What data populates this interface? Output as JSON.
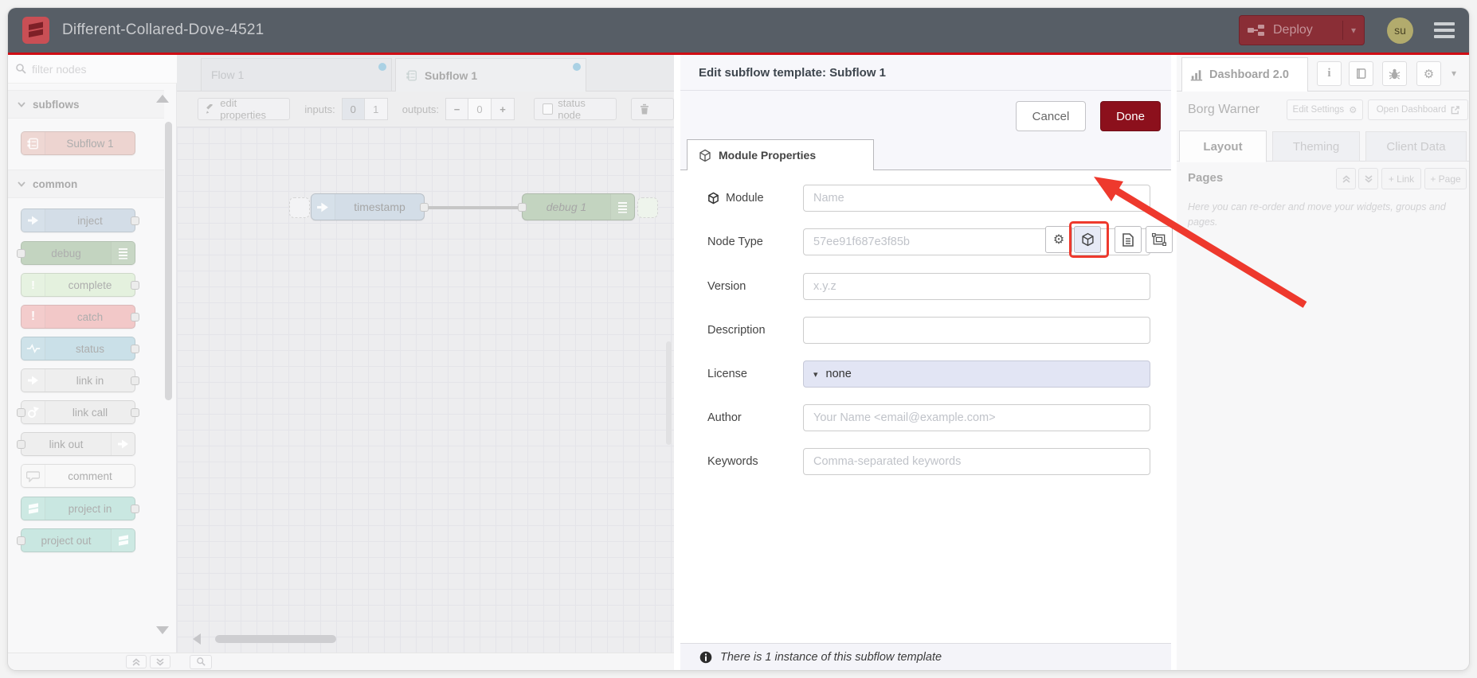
{
  "header": {
    "title": "Different-Collared-Dove-4521",
    "deploy_label": "Deploy",
    "avatar_initials": "su"
  },
  "icons": {
    "caret_down": "▾",
    "gear": "⚙",
    "plus": "+",
    "minus": "−",
    "info_i": "i"
  },
  "workspace_tabs": {
    "flow": "Flow 1",
    "subflow": "Subflow 1"
  },
  "palette": {
    "filter_placeholder": "filter nodes",
    "categories": [
      {
        "label": "subflows",
        "nodes": [
          {
            "label": "Subflow 1",
            "color": "#dba9a0"
          }
        ]
      },
      {
        "label": "common",
        "nodes": [
          {
            "label": "inject",
            "color": "#a6bbcf"
          },
          {
            "label": "debug",
            "color": "#87a980"
          },
          {
            "label": "complete",
            "color": "#c8e2bd"
          },
          {
            "label": "catch",
            "color": "#e49191"
          },
          {
            "label": "status",
            "color": "#94c1d0"
          },
          {
            "label": "link in",
            "color": "#dddddd"
          },
          {
            "label": "link call",
            "color": "#dddddd"
          },
          {
            "label": "link out",
            "color": "#dddddd"
          },
          {
            "label": "comment",
            "color": "#f0f0f0"
          },
          {
            "label": "project in",
            "color": "#93cfc2"
          },
          {
            "label": "project out",
            "color": "#93cfc2"
          }
        ]
      }
    ]
  },
  "toolbar": {
    "edit_properties": "edit properties",
    "inputs_label": "inputs:",
    "input_low": "0",
    "input_high": "1",
    "outputs_label": "outputs:",
    "outputs_value": "0",
    "status_node": "status node"
  },
  "canvas": {
    "nodes": [
      {
        "label": "timestamp",
        "color": "#a6bbcf"
      },
      {
        "label": "debug 1",
        "color": "#87a980"
      }
    ]
  },
  "dialog": {
    "title": "Edit subflow template: Subflow 1",
    "cancel_label": "Cancel",
    "done_label": "Done",
    "tab_label": "Module Properties",
    "fields": [
      {
        "label": "Module",
        "placeholder": "Name"
      },
      {
        "label": "Node Type",
        "placeholder": "57ee91f687e3f85b"
      },
      {
        "label": "Version",
        "placeholder": "x.y.z"
      },
      {
        "label": "Description",
        "placeholder": ""
      },
      {
        "label": "License",
        "value": "none"
      },
      {
        "label": "Author",
        "placeholder": "Your Name <email@example.com>"
      },
      {
        "label": "Keywords",
        "placeholder": "Comma-separated keywords"
      }
    ],
    "footer_info": "There is 1 instance of this subflow template"
  },
  "sidebar": {
    "tab_label": "Dashboard 2.0",
    "project_name": "Borg Warner",
    "edit_settings_label": "Edit Settings",
    "open_dashboard_label": "Open Dashboard",
    "tabs": [
      "Layout",
      "Theming",
      "Client Data"
    ],
    "pages": {
      "heading": "Pages",
      "link_label": "+ Link",
      "page_label": "+ Page",
      "help_text": "Here you can re-order and move your widgets, groups and pages."
    }
  },
  "colors": {
    "header_bg": "#575e66",
    "deploy_red": "#8a2e36",
    "changes_line": "#cf0d14",
    "done_button": "#8c101c",
    "annotation_red": "#ee392d",
    "tab_dot_blue": "#55a3c9",
    "license_bg": "#e2e5f4",
    "avatar_bg": "#b2ab6d"
  }
}
